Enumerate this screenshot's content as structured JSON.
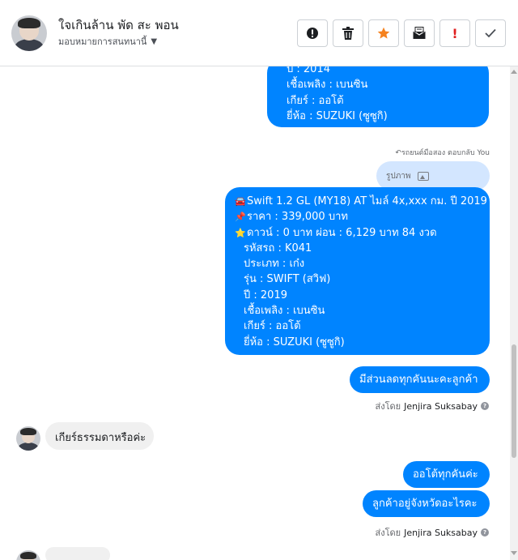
{
  "header": {
    "name": "ใจเกินล้าน พัด สะ พอน",
    "assign_label": "มอบหมายการสนทนานี้",
    "actions": [
      {
        "name": "report-icon",
        "label": "!"
      },
      {
        "name": "trash-icon",
        "label": ""
      },
      {
        "name": "star-icon",
        "label": ""
      },
      {
        "name": "mark-unread-icon",
        "label": ""
      },
      {
        "name": "spam-icon",
        "label": "!"
      },
      {
        "name": "done-icon",
        "label": ""
      }
    ],
    "colors": {
      "star": "#f5821f",
      "spam": "#e02020"
    }
  },
  "thread": {
    "outgoing_1": {
      "lines": [
        "ปี : 2014",
        "เชื้อเพลิง : เบนซิน",
        "เกียร์ : ออโต้",
        "ยี่ห้อ : SUZUKI (ซูซูกิ)"
      ]
    },
    "reply_note": "รถยนต์มือสอง ตอบกลับ You",
    "image_pill_label": "รูปภาพ",
    "outgoing_2": {
      "line_1_icon": "🚘",
      "line_1": "Swift 1.2 GL (MY18) AT ไมล์ 4x,xxx กม. ปี 2019",
      "line_2_icon": "📌",
      "line_2": "ราคา : 339,000 บาท",
      "line_3_icon": "⭐",
      "line_3": "ดาวน์ : 0 บาท ผ่อน : 6,129 บาท 84 งวด",
      "lines": [
        "รหัสรถ : K041",
        "ประเภท : เก๋ง",
        "รุ่น : SWIFT (สวิฟ)",
        "ปี : 2019",
        "เชื้อเพลิง : เบนซิน",
        "เกียร์ : ออโต้",
        "ยี่ห้อ : SUZUKI (ซูซูกิ)"
      ]
    },
    "outgoing_3": "มีส่วนลดทุกคันนะคะลูกค้า",
    "sent_by_prefix": "ส่งโดย",
    "sent_by_name": "Jenjira Suksabay",
    "incoming_1": "เกียร์ธรรมดาหรือค่ะ",
    "outgoing_4": "ออโต้ทุกคันค่ะ",
    "outgoing_5": "ลูกค้าอยู่จังหวัดอะไรคะ",
    "bubble_color": "#0084ff"
  }
}
